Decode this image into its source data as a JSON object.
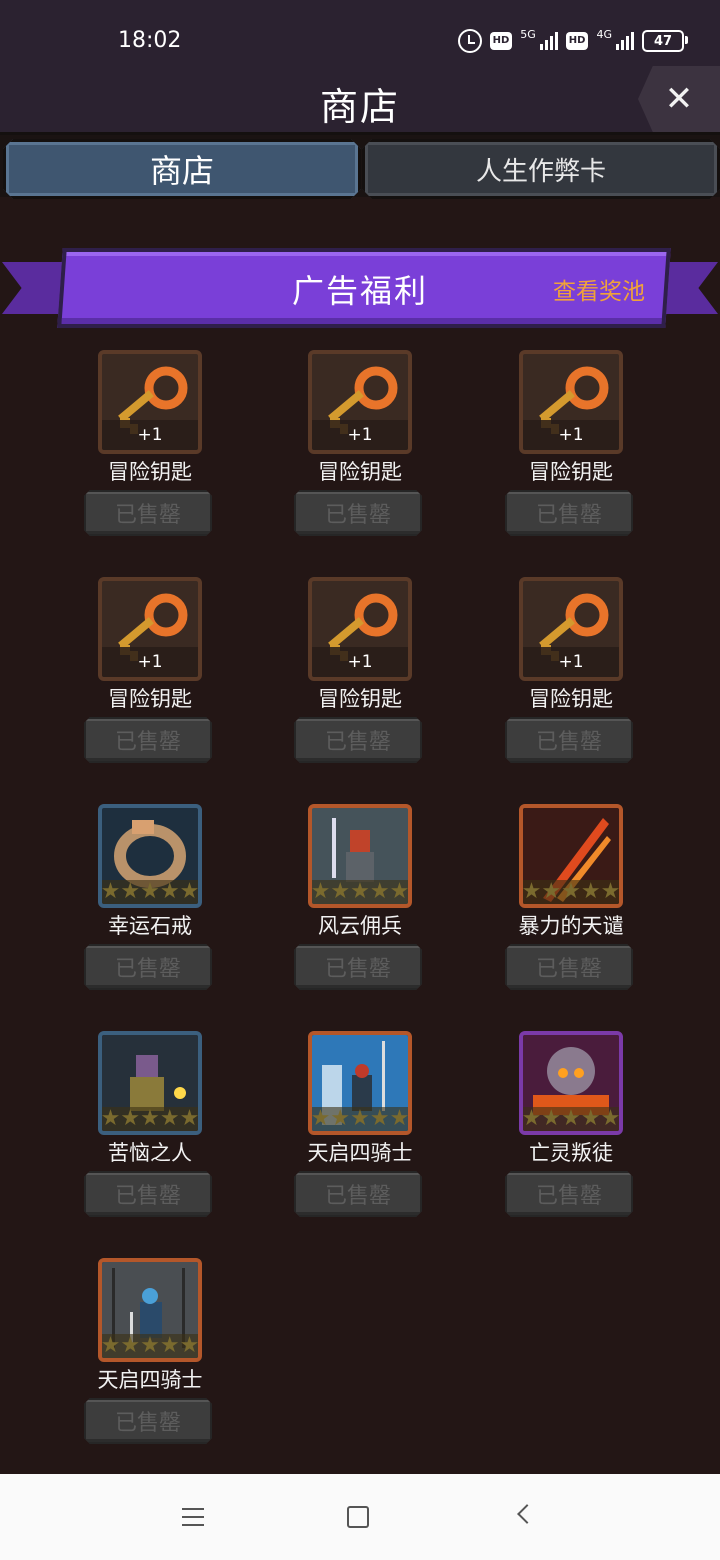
{
  "status_bar": {
    "time": "18:02",
    "net1": "5G",
    "net2": "4G",
    "battery": "47"
  },
  "header": {
    "title": "商店"
  },
  "tabs": [
    {
      "label": "商店"
    },
    {
      "label": "人生作弊卡"
    }
  ],
  "banner": {
    "title": "广告福利",
    "link": "查看奖池"
  },
  "sold_label": "已售罄",
  "qty_label": "+1",
  "items": [
    {
      "name": "冒险钥匙"
    },
    {
      "name": "冒险钥匙"
    },
    {
      "name": "冒险钥匙"
    },
    {
      "name": "冒险钥匙"
    },
    {
      "name": "冒险钥匙"
    },
    {
      "name": "冒险钥匙"
    },
    {
      "name": "幸运石戒"
    },
    {
      "name": "风云佣兵"
    },
    {
      "name": "暴力的天谴"
    },
    {
      "name": "苦恼之人"
    },
    {
      "name": "天启四骑士"
    },
    {
      "name": "亡灵叛徒"
    },
    {
      "name": "天启四骑士"
    }
  ],
  "colors": {
    "accent_purple": "#7a3fd8",
    "link_orange": "#f0a23a",
    "background": "#231615"
  }
}
